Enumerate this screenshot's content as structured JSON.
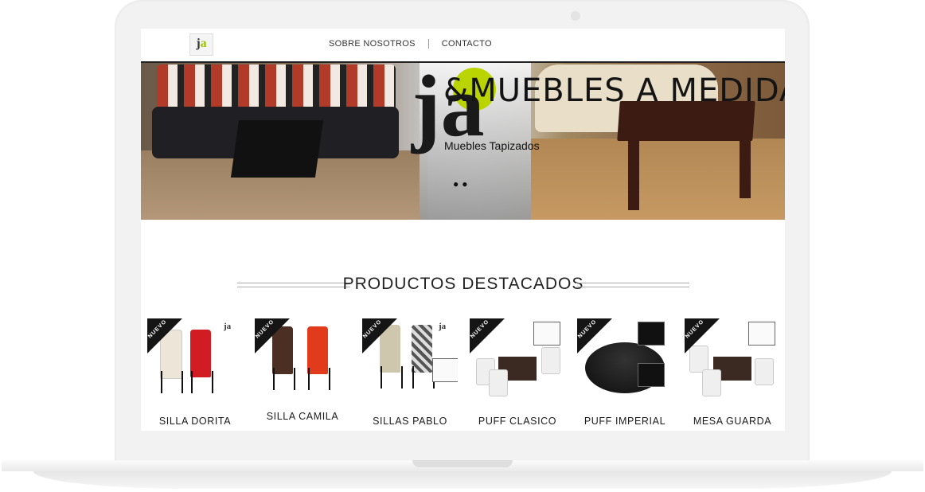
{
  "header": {
    "logo_text_j": "j",
    "logo_text_a": "a",
    "nav": [
      {
        "label": "SOBRE NOSOTROS"
      },
      {
        "label": "CONTACTO"
      }
    ]
  },
  "hero": {
    "title": "&MUEBLES A MEDIDA",
    "subtitle": "Muebles Tapizados",
    "logo_j": "ja"
  },
  "section": {
    "title": "PRODUCTOS DESTACADOS"
  },
  "products": [
    {
      "name": "SILLA DORITA",
      "badge": "NUEVO"
    },
    {
      "name": "SILLA CAMILA",
      "badge": "NUEVO"
    },
    {
      "name": "SILLAS PABLO",
      "badge": "NUEVO"
    },
    {
      "name": "PUFF CLASICO",
      "badge": "NUEVO"
    },
    {
      "name": "PUFF IMPERIAL",
      "badge": "NUEVO"
    },
    {
      "name": "MESA GUARDA",
      "badge": "NUEVO"
    }
  ],
  "colors": {
    "accent": "#b9d400",
    "ribbon": "#151515"
  }
}
